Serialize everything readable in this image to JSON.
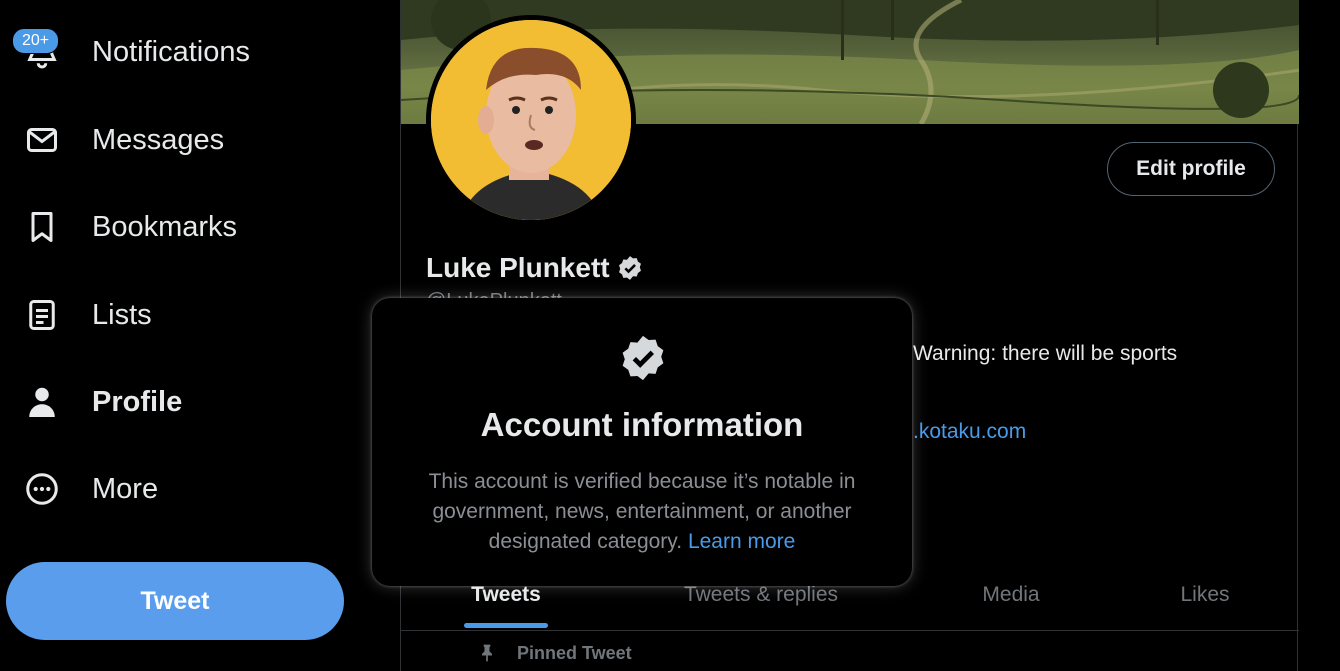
{
  "sidebar": {
    "notifications_badge": "20+",
    "items": [
      {
        "label": "Notifications",
        "icon": "bell-icon"
      },
      {
        "label": "Messages",
        "icon": "envelope-icon"
      },
      {
        "label": "Bookmarks",
        "icon": "bookmark-icon"
      },
      {
        "label": "Lists",
        "icon": "list-icon"
      },
      {
        "label": "Profile",
        "icon": "person-icon"
      },
      {
        "label": "More",
        "icon": "more-circle-icon"
      }
    ],
    "tweet_button": "Tweet"
  },
  "profile": {
    "display_name": "Luke Plunkett",
    "handle": "@LukePlunkett",
    "edit_button": "Edit profile",
    "bio_visible": "Warning: there will be sports",
    "link_visible": ".kotaku.com"
  },
  "tabs": [
    {
      "label": "Tweets",
      "active": true
    },
    {
      "label": "Tweets & replies",
      "active": false
    },
    {
      "label": "Media",
      "active": false
    },
    {
      "label": "Likes",
      "active": false
    }
  ],
  "pinned_label": "Pinned Tweet",
  "popover": {
    "title": "Account information",
    "body": "This account is verified because it’s notable in government, news, entertainment, or another designated category.",
    "link": "Learn more"
  },
  "colors": {
    "accent": "#4a9ae8",
    "tweet_button": "#5b9ded",
    "avatar_bg": "#f2bd32",
    "background": "#000000"
  }
}
